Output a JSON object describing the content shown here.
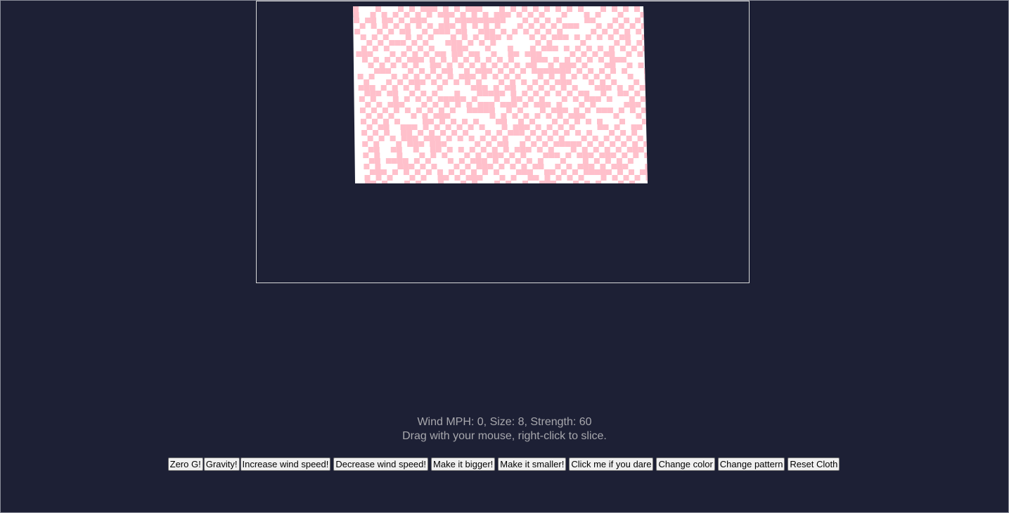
{
  "status": {
    "wind_mph": "Wind MPH: 0, Size: 8, Strength: 60",
    "instructions": "Drag with your mouse, right-click to slice."
  },
  "cloth": {
    "primary_color": "#ffc0cb",
    "secondary_color": "#ffffff"
  },
  "buttons": {
    "zero_g": "Zero G!",
    "gravity": "Gravity!",
    "increase_wind": "Increase wind speed!",
    "decrease_wind": "Decrease wind speed!",
    "bigger": "Make it bigger!",
    "smaller": "Make it smaller!",
    "dare": "Click me if you dare",
    "change_color": "Change color",
    "change_pattern": "Change pattern",
    "reset": "Reset Cloth"
  },
  "colors": {
    "background": "#1d2035",
    "text": "#a8a8ad"
  }
}
